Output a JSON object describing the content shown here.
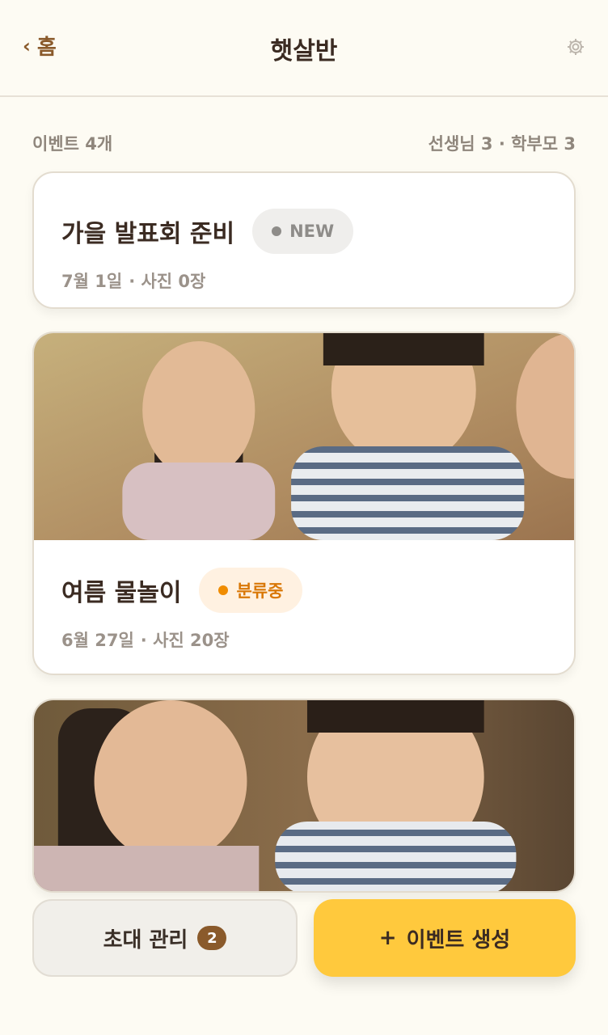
{
  "header": {
    "back_icon": "chevron-left-icon",
    "back_label": "홈",
    "title": "햇살반",
    "settings_icon": "gear-icon"
  },
  "meta": {
    "events_label": "이벤트",
    "events_count": "4개",
    "counts": "선생님 3 · 학부모 3"
  },
  "events": [
    {
      "title": "가을 발표회 준비",
      "badge": "NEW",
      "date": "7월 1일",
      "photos": "· 사진 0장"
    },
    {
      "title": "여름 물놀이",
      "badge": "분류중",
      "date": "6월 27일",
      "photos": "· 사진 20장"
    }
  ],
  "bottom": {
    "invite_label": "초대 관리",
    "invite_count": "2",
    "create_plus": "+",
    "create_label": "이벤트 생성"
  },
  "colors": {
    "accent": "#ffc93d",
    "brand_brown": "#8a5a2b",
    "status_new": "#8e8c89",
    "status_sorting": "#f08c00"
  }
}
